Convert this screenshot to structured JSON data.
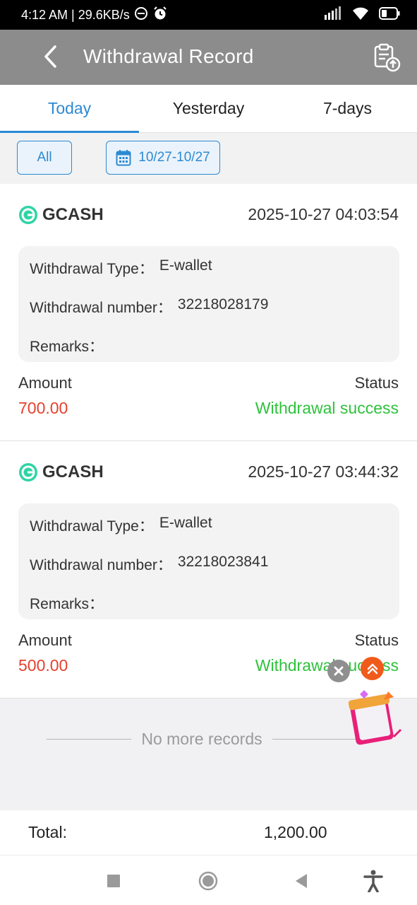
{
  "status_bar": {
    "time_speed": "4:12 AM | 29.6KB/s"
  },
  "header": {
    "title": "Withdrawal Record"
  },
  "tabs": [
    {
      "label": "Today",
      "active": true
    },
    {
      "label": "Yesterday",
      "active": false
    },
    {
      "label": "7-days",
      "active": false
    }
  ],
  "filters": {
    "all_label": "All",
    "date_range": "10/27-10/27"
  },
  "records": [
    {
      "provider": "GCASH",
      "datetime": "2025-10-27 04:03:54",
      "type_label": "Withdrawal Type：",
      "type_value": "E-wallet",
      "number_label": "Withdrawal number：",
      "number_value": "32218028179",
      "remarks_label": "Remarks：",
      "amount_label": "Amount",
      "amount_value": "700.00",
      "status_label": "Status",
      "status_value": "Withdrawal success"
    },
    {
      "provider": "GCASH",
      "datetime": "2025-10-27 03:44:32",
      "type_label": "Withdrawal Type：",
      "type_value": "E-wallet",
      "number_label": "Withdrawal number：",
      "number_value": "32218023841",
      "remarks_label": "Remarks：",
      "amount_label": "Amount",
      "amount_value": "500.00",
      "status_label": "Status",
      "status_value": "Withdrawal success"
    }
  ],
  "footer": {
    "no_more": "No more records",
    "total_label": "Total:",
    "total_value": "1,200.00"
  },
  "colors": {
    "accent": "#2c8ad3",
    "amount": "#e5412e",
    "success": "#2ec23c",
    "header_bg": "#8c8c8c",
    "gcash": "#2fd3a6"
  }
}
